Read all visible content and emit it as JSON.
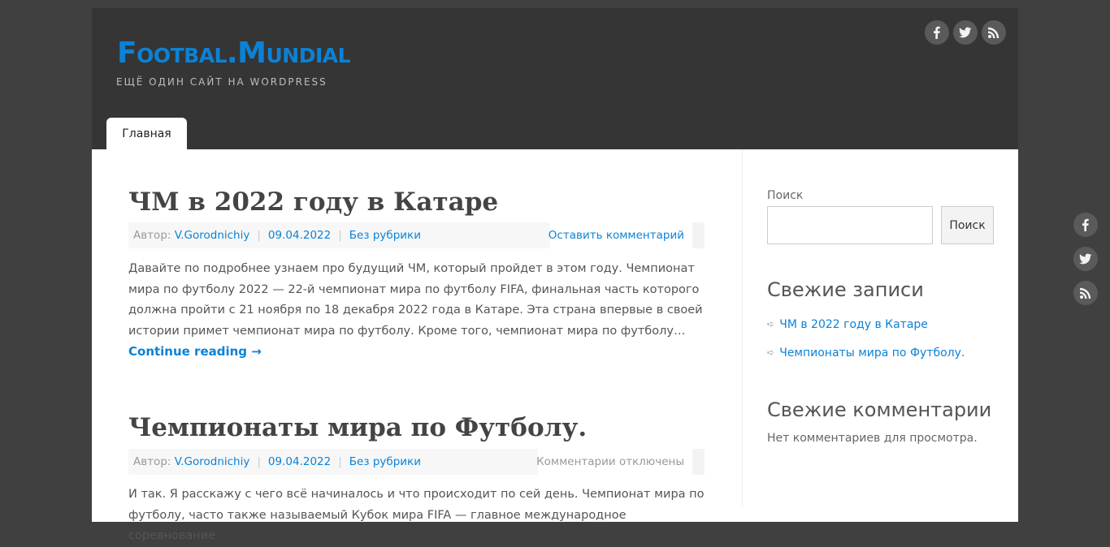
{
  "site": {
    "title": "Footbal.Mundial",
    "description": "ЕЩЁ ОДИН САЙТ НА WORDPRESS"
  },
  "nav": {
    "home": "Главная"
  },
  "social": [
    "facebook-icon",
    "twitter-icon",
    "rss-icon"
  ],
  "posts": [
    {
      "title": "ЧМ в 2022 году в Катаре",
      "author_label": "Автор:",
      "author": "V.Gorodnichiy",
      "date": "09.04.2022",
      "category": "Без рубрики",
      "comments": "Оставить комментарий",
      "excerpt": "Давайте по подробнее узнаем про будущий ЧМ, который пройдет в этом году. Чемпионат мира по футболу 2022 — 22-й чемпионат мира по футболу FIFA, финальная часть которого должна пройти с 21 ноября по 18 декабря 2022 года в Катаре. Эта страна впервые в своей истории примет чемпионат мира по футболу. Кроме того, чемпионат мира по футболу…",
      "more": "Continue reading →"
    },
    {
      "title": "Чемпионаты мира по Футболу.",
      "author_label": "Автор:",
      "author": "V.Gorodnichiy",
      "date": "09.04.2022",
      "category": "Без рубрики",
      "comments": "Комментарии отключены",
      "excerpt": "И так. Я расскажу с чего всё начиналось и что происходит по сей день. Чемпионат мира по футболу, часто также называемый Кубок мира FIFA — главное международное соревнование"
    }
  ],
  "sidebar": {
    "search_label": "Поиск",
    "search_button": "Поиск",
    "search_value": "",
    "recent_posts_title": "Свежие записи",
    "recent_posts": [
      "ЧМ в 2022 году в Катаре",
      "Чемпионаты мира по Футболу."
    ],
    "recent_comments_title": "Свежие комментарии",
    "no_comments": "Нет комментариев для просмотра."
  },
  "colors": {
    "accent": "#0b82d6",
    "header_bg": "#353535",
    "page_bg": "#404040"
  }
}
